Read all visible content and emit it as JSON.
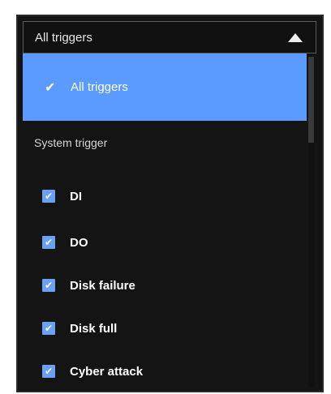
{
  "dropdown": {
    "selected_label": "All triggers",
    "caret_icon": "caret-up-icon"
  },
  "menu": {
    "selected_item": {
      "label": "All triggers",
      "check_glyph": "✔",
      "checked": true
    },
    "section_label": "System trigger",
    "options": [
      {
        "label": "DI",
        "checked": true
      },
      {
        "label": "DO",
        "checked": true
      },
      {
        "label": "Disk failure",
        "checked": true
      },
      {
        "label": "Disk full",
        "checked": true
      },
      {
        "label": "Cyber attack",
        "checked": true
      }
    ],
    "checkbox_glyph": "✔",
    "colors": {
      "accent": "#5b9aff",
      "checkbox": "#6aa1f5",
      "background": "#141414"
    }
  }
}
